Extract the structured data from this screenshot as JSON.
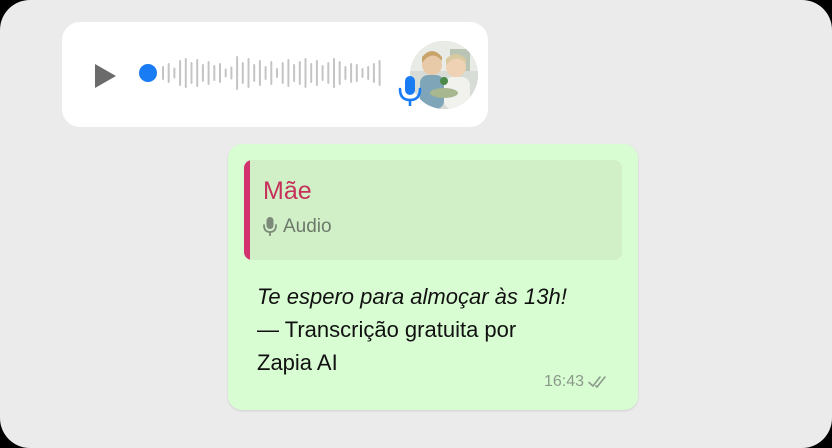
{
  "voice_message": {
    "waveform_bars": [
      14,
      20,
      11,
      26,
      30,
      22,
      28,
      18,
      24,
      16,
      20,
      9,
      13,
      34,
      22,
      30,
      18,
      26,
      14,
      24,
      10,
      22,
      28,
      18,
      24,
      30,
      20,
      26,
      16,
      22,
      30,
      24,
      14,
      20,
      18,
      10,
      14,
      20,
      26
    ],
    "progress": 0,
    "accent_color": "#1a7cf5"
  },
  "reply": {
    "quote_name": "Mãe",
    "quote_label": "Audio",
    "text_italic": "Te espero para almoçar às 13h!",
    "text_line2": "— Transcrição gratuita por",
    "text_line3": "Zapia AI",
    "time": "16:43"
  },
  "colors": {
    "background": "#ebebeb",
    "bubble_in": "#ffffff",
    "bubble_out": "#d9fdd3",
    "quote_accent": "#d2326e"
  }
}
